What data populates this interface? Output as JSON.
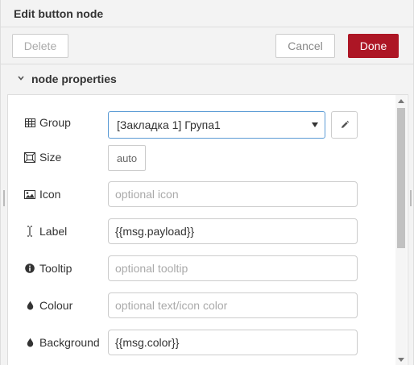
{
  "header": {
    "title": "Edit button node"
  },
  "toolbar": {
    "delete_label": "Delete",
    "cancel_label": "Cancel",
    "done_label": "Done"
  },
  "section": {
    "title": "node properties"
  },
  "form": {
    "group": {
      "label": "Group",
      "value": "[Закладка 1] Група1",
      "icon": "table-icon"
    },
    "size": {
      "label": "Size",
      "value": "auto",
      "icon": "resize-icon"
    },
    "icon": {
      "label": "Icon",
      "placeholder": "optional icon",
      "icon": "picture-icon"
    },
    "label": {
      "label": "Label",
      "value": "{{msg.payload}}",
      "icon": "text-cursor-icon"
    },
    "tooltip": {
      "label": "Tooltip",
      "placeholder": "optional tooltip",
      "icon": "info-icon"
    },
    "colour": {
      "label": "Colour",
      "placeholder": "optional text/icon color",
      "icon": "droplet-icon"
    },
    "background": {
      "label": "Background",
      "value": "{{msg.color}}",
      "icon": "droplet-icon"
    }
  },
  "colors": {
    "accent": "#ad1625",
    "focus_border": "#5b9bd5"
  }
}
